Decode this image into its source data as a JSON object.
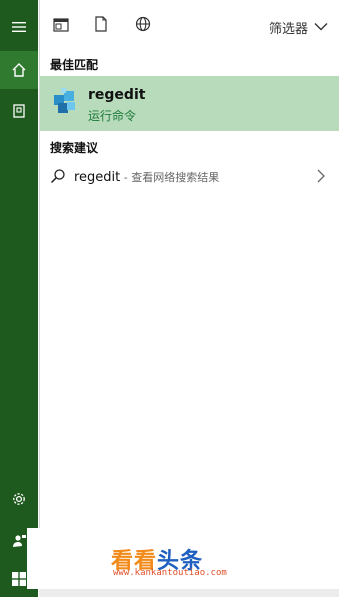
{
  "sidebar": {
    "bg_color": "#1e5a1e",
    "items": [
      {
        "icon": "hamburger-menu-icon"
      },
      {
        "icon": "home-icon",
        "active": true
      },
      {
        "icon": "notebook-icon"
      },
      {
        "icon": "settings-gear-icon"
      },
      {
        "icon": "feedback-person-icon"
      },
      {
        "icon": "windows-start-icon"
      }
    ]
  },
  "toolbar": {
    "icons": [
      "app-window-icon",
      "document-icon",
      "globe-icon"
    ],
    "filter_label": "筛选器",
    "filter_icon": "chevron-down-icon"
  },
  "best_match": {
    "section_title": "最佳匹配",
    "title": "regedit",
    "subtitle": "运行命令",
    "icon": "registry-editor-icon",
    "highlight_color": "#b7dbbb"
  },
  "suggestions": {
    "section_title": "搜索建议",
    "items": [
      {
        "query": "regedit",
        "suffix": " - 查看网络搜索结果",
        "icon": "search-icon"
      }
    ]
  },
  "watermark": {
    "text_a": "看看",
    "text_b": "头条",
    "url": "www.kankantoutiao.com"
  }
}
